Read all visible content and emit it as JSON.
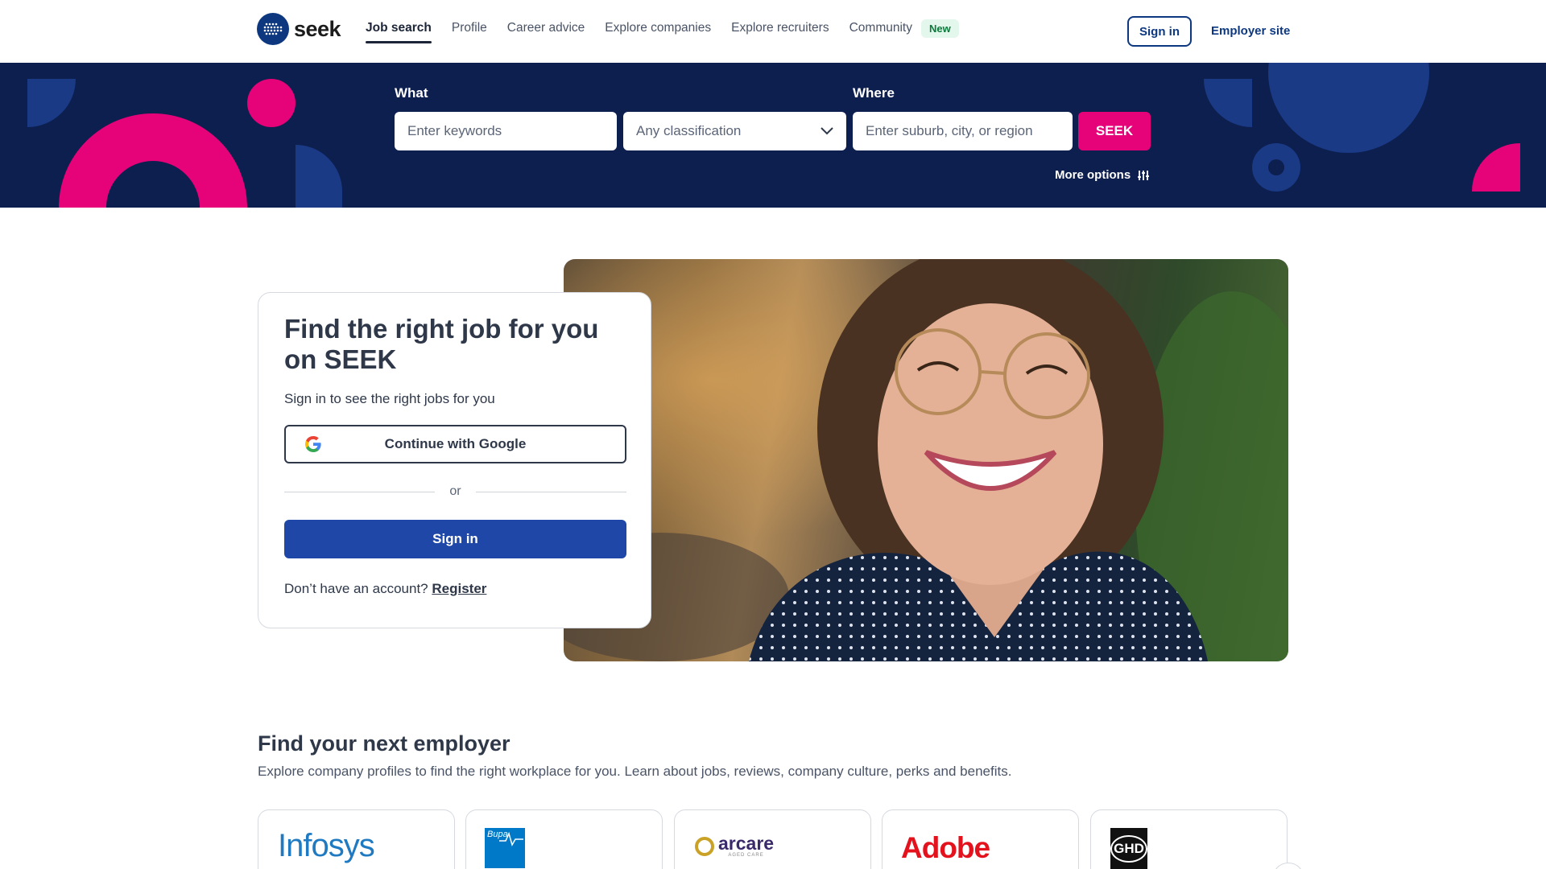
{
  "header": {
    "logo_text": "seek",
    "nav": [
      {
        "label": "Job search",
        "active": true
      },
      {
        "label": "Profile"
      },
      {
        "label": "Career advice"
      },
      {
        "label": "Explore companies"
      },
      {
        "label": "Explore recruiters"
      },
      {
        "label": "Community"
      }
    ],
    "new_badge": "New",
    "sign_in": "Sign in",
    "employer_site": "Employer site"
  },
  "search": {
    "what_label": "What",
    "where_label": "Where",
    "keywords_placeholder": "Enter keywords",
    "classification_value": "Any classification",
    "location_placeholder": "Enter suburb, city, or region",
    "submit_label": "SEEK",
    "more_options": "More options",
    "colors": {
      "banner": "#0d1f4f",
      "accent": "#e60278"
    }
  },
  "signin_card": {
    "title": "Find the right job for you on SEEK",
    "subtitle": "Sign in to see the right jobs for you",
    "google_button": "Continue with Google",
    "divider": "or",
    "sign_in_button": "Sign in",
    "no_account_text": "Don’t have an account?",
    "register_link": "Register"
  },
  "employers": {
    "title": "Find your next employer",
    "subtitle": "Explore company profiles to find the right workplace for you. Learn about jobs, reviews, company culture, perks and benefits.",
    "companies": [
      {
        "name": "Infosys"
      },
      {
        "name": "Bupa"
      },
      {
        "name": "arcare",
        "tagline": "AGED CARE"
      },
      {
        "name": "Adobe"
      },
      {
        "name": "GHD"
      }
    ]
  }
}
